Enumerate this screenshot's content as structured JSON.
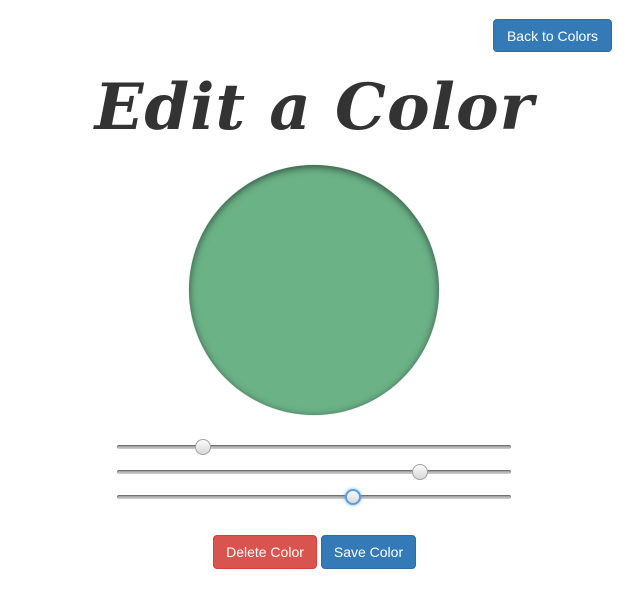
{
  "nav": {
    "back_label": "Back to Colors"
  },
  "page": {
    "title": "Edit a Color"
  },
  "swatch": {
    "color": "#6bb287"
  },
  "sliders": [
    {
      "value": 0.205,
      "focused": false
    },
    {
      "value": 0.782,
      "focused": false
    },
    {
      "value": 0.605,
      "focused": true
    }
  ],
  "actions": {
    "delete_label": "Delete Color",
    "save_label": "Save Color"
  },
  "colors": {
    "primary": "#337ab7",
    "danger": "#d9534f",
    "title": "#333333"
  }
}
